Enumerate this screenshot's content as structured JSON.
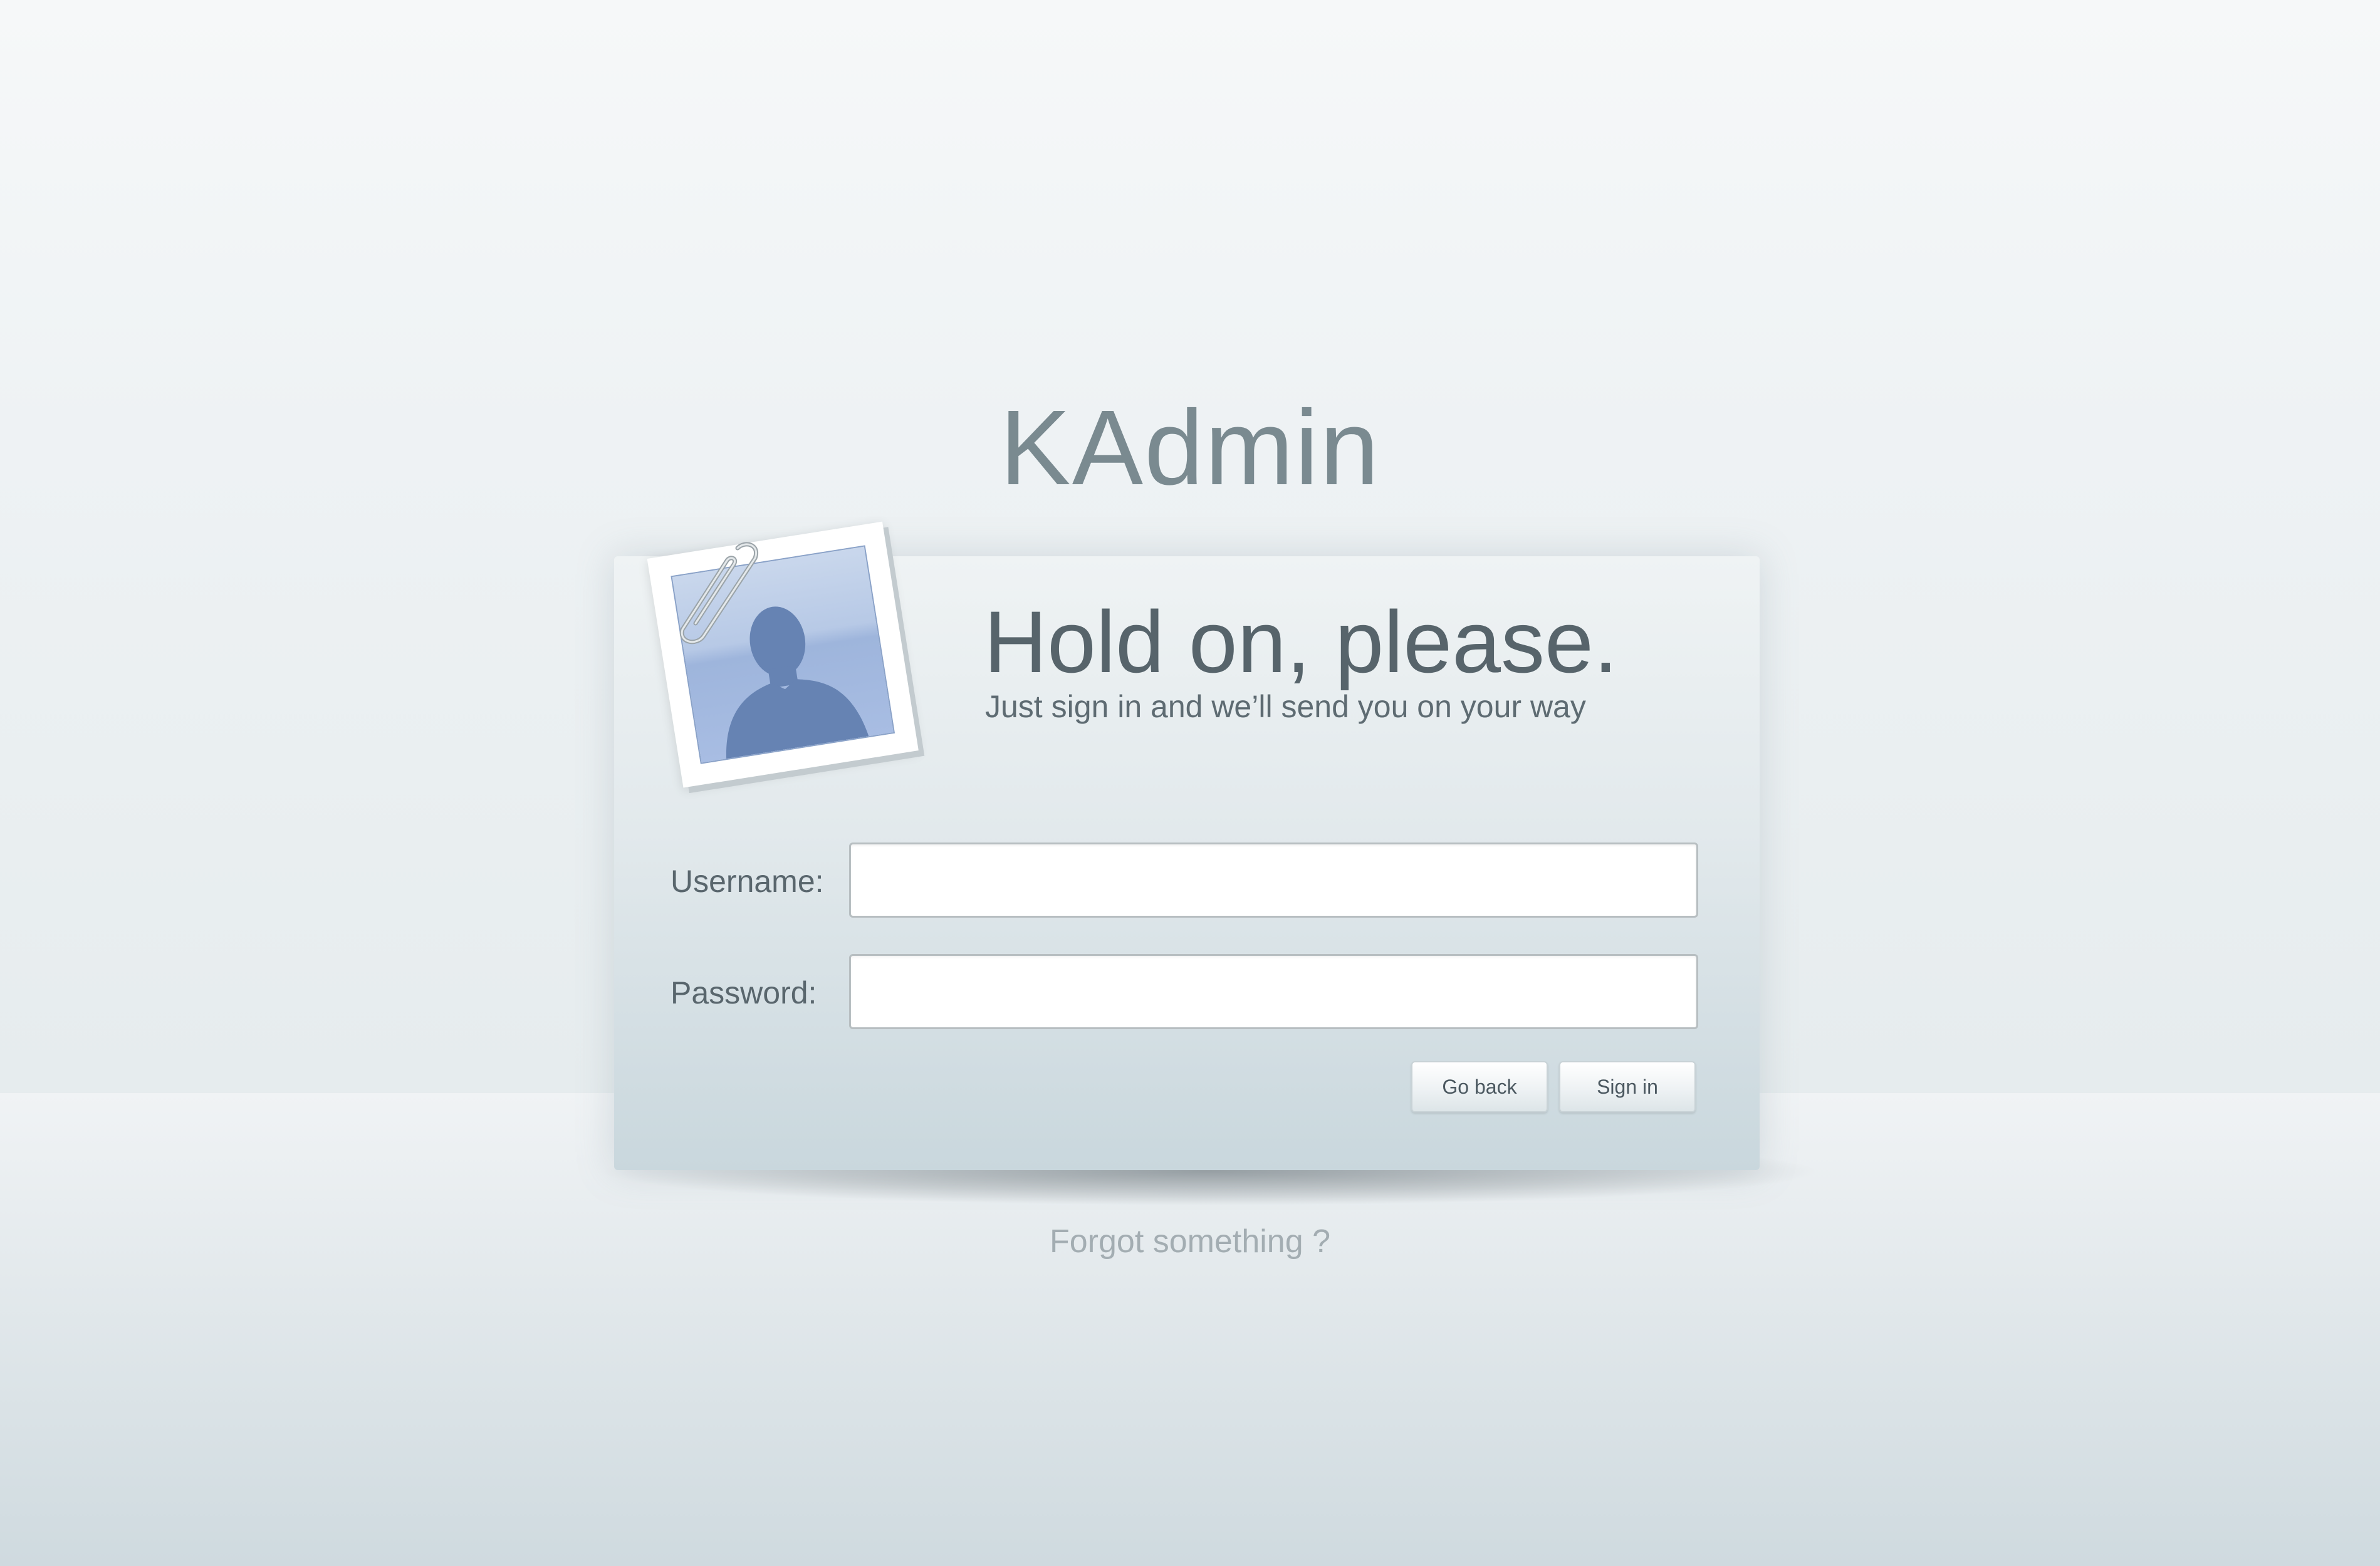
{
  "app": {
    "title": "KAdmin"
  },
  "login_card": {
    "heading": "Hold on, please.",
    "subheading": "Just sign in and we’ll send you on your way",
    "avatar_icon": "user-silhouette-photo-icon",
    "clip_icon": "paperclip-icon",
    "username_label": "Username:",
    "username_value": "",
    "password_label": "Password:",
    "password_value": "",
    "go_back_label": "Go back",
    "sign_in_label": "Sign in"
  },
  "footer": {
    "forgot_link": "Forgot something ?"
  },
  "colors": {
    "title": "#7a8a90",
    "heading": "#57646b",
    "avatar_fill": "#6683b3",
    "photo_sky": "#b7c9e6",
    "link": "#a3adb2"
  }
}
